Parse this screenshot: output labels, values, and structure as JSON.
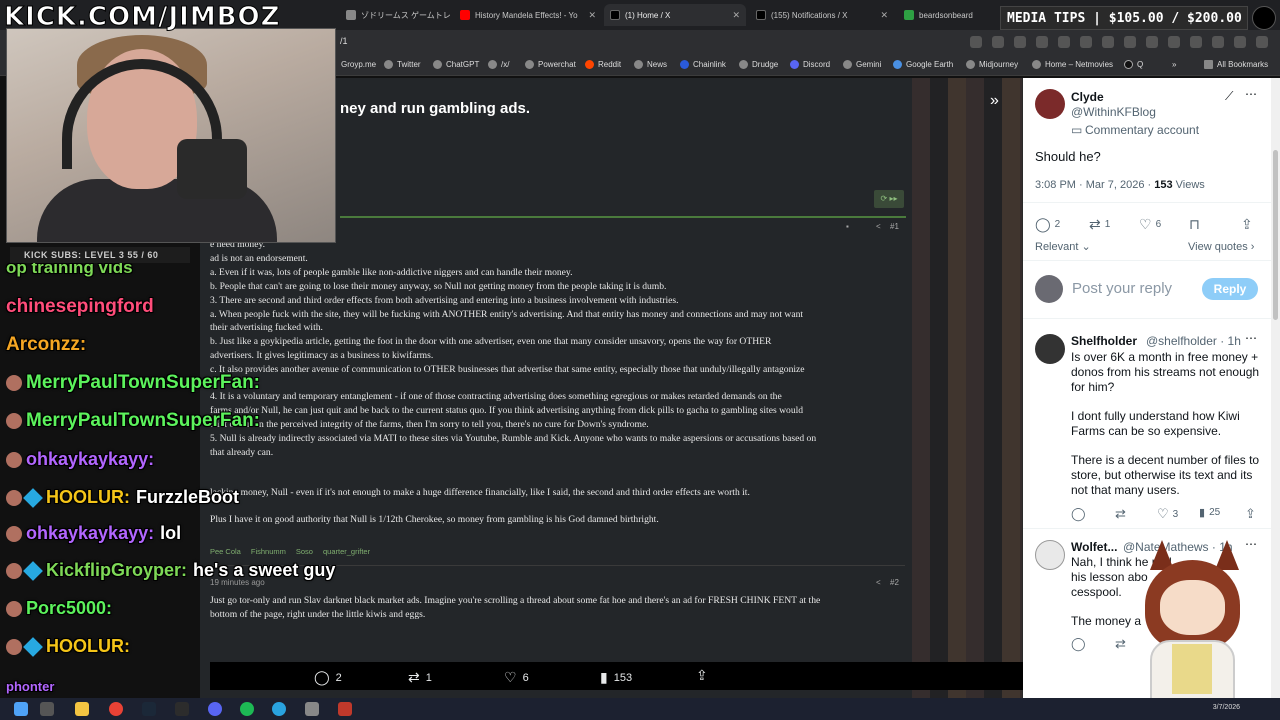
{
  "overlay": {
    "kick_logo": "KICK.COM/JIMBOZ",
    "media_tips": "MEDIA TIPS | $105.00 / $200.00",
    "subs": "KICK SUBS: LEVEL 3 55 / 60"
  },
  "browser": {
    "tabs": [
      {
        "label": "ゾドリームス ゲームトレ",
        "color": "#888"
      },
      {
        "label": "History Mandela Effects! - Yo",
        "color": "#ff0000"
      },
      {
        "label": "(1) Home / X",
        "color": "#000000"
      },
      {
        "label": "(155) Notifications / X",
        "color": "#000000"
      },
      {
        "label": "beardsonbeard",
        "color": "#2ea043"
      }
    ],
    "url": "/1",
    "bookmarks": [
      "Groyp.me",
      "Twitter",
      "ChatGPT",
      "/x/",
      "Powerchat",
      "Reddit",
      "News",
      "Chainlink",
      "Drudge",
      "Discord",
      "Gemini",
      "Google Earth",
      "Midjourney",
      "Home – Netmovies",
      "Q",
      "All Bookmarks"
    ]
  },
  "forum": {
    "thread_title": "ney and run gambling ads.",
    "post1_num": "#1",
    "post1_lines": [
      "e need money.",
      "ad is not an endorsement.",
      "a. Even if it was, lots of people gamble like non-addictive niggers and can handle their money.",
      "b. People that can't are going to lose their money anyway, so Null not getting money from the people taking it is dumb.",
      "3. There are second and third order effects from both advertising and entering into a business involvement with industries.",
      "a. When people fuck with the site, they will be fucking with ANOTHER entity's advertising. And that entity has money and connections and may not want",
      "their advertising fucked with.",
      "b. Just like a goykipedia article, getting the foot in the door with one advertiser, even one that many consider unsavory, opens the way for OTHER",
      "advertisers. It gives legitimacy as a business to kiwifarms.",
      "c. It also provides another avenue of communication to OTHER businesses that advertise that same entity, especially those that unduly/illegally antagonize",
      "",
      "4. It is a voluntary and temporary entanglement - if one of those contracting advertising does something egregious or makes retarded demands on the",
      "farms and/or Null, he can just quit and be back to the current status quo. If you think advertising anything from dick pills to gacha to gambling sites would",
      "taint or d         n on the perceived integrity of the farms, then I'm sorry to tell you, there's no cure for Down's syndrome.",
      "5. Null is already indirectly associated via MATI to these sites via Youtube, Rumble and Kick. Anyone who wants to make aspersions or accusations based on",
      "that already can.",
      "",
      "",
      "         lacking money, Null - even if it's not enough to make a huge difference financially, like I said, the second and third order effects are worth it.",
      "",
      "Plus I have it on good authority that Null is 1/12th Cherokee, so money from gambling is his God damned birthright."
    ],
    "reactions": [
      "Pee Cola",
      "Fishnumm",
      "Soso",
      "quarter_grifter"
    ],
    "post2_ago": "19 minutes ago",
    "post2_num": "#2",
    "post2_lines": [
      "Just go tor-only and run Slav darknet black market ads. Imagine you're scrolling a thread about some fat hoe and there's an ad for FRESH CHINK FENT at the",
      "bottom of the page, right under the little kiwis and eggs."
    ]
  },
  "chat": [
    {
      "user": "op training vids",
      "text": "",
      "color": "#7ed957"
    },
    {
      "user": "chinesepingford",
      "text": "",
      "color": "#ff4d7a"
    },
    {
      "user": "Arconzz:",
      "text": "",
      "color": "#f5a623"
    },
    {
      "user": "MerryPaulTownSuperFan:",
      "text": "",
      "color": "#5cf25c"
    },
    {
      "user": "MerryPaulTownSuperFan:",
      "text": "",
      "color": "#5cf25c"
    },
    {
      "user": "ohkaykaykayy:",
      "text": "",
      "color": "#b266ff"
    },
    {
      "user": "HOOLUR:",
      "text": "FurzzleBoot",
      "color": "#f5c518"
    },
    {
      "user": "ohkaykaykayy:",
      "text": "lol",
      "color": "#b266ff"
    },
    {
      "user": "KickflipGroyper:",
      "text": "he's a sweet guy",
      "color": "#7ed957"
    },
    {
      "user": "Porc5000:",
      "text": "",
      "color": "#5cf25c"
    },
    {
      "user": "HOOLUR:",
      "text": "",
      "color": "#f5c518"
    },
    {
      "user": "phonter",
      "text": "",
      "color": "#b266ff"
    }
  ],
  "engagement": {
    "replies": "2",
    "reposts": "1",
    "likes": "6",
    "views": "153"
  },
  "twitter": {
    "author_name": "Clyde",
    "author_handle": "@WithinKFBlog",
    "author_label": "Commentary account",
    "tweet_text": "Should he?",
    "timestamp": "3:08 PM · Mar 7, 2026 · ",
    "views_count": "153",
    "views_label": " Views",
    "replies": "2",
    "reposts": "1",
    "likes": "6",
    "relevant": "Relevant",
    "view_quotes": "View quotes",
    "reply_placeholder": "Post your reply",
    "reply_button": "Reply",
    "replies_list": [
      {
        "name": "Shelfholder",
        "handle": "@shelfholder · 1h",
        "lines": [
          "Is over 6K a month in free money +",
          "donos from his streams not enough",
          "for him?",
          "",
          "I dont fully understand how Kiwi",
          "Farms can be so expensive.",
          "",
          "There is a decent number of files to",
          "store, but otherwise its text and its",
          "not that many users."
        ],
        "likes": "3",
        "views": "25"
      },
      {
        "name": "Wolfet...",
        "handle": "@NateMathews · 1h",
        "lines": [
          "Nah, I think he             ned",
          "his lesson abo",
          "cesspool.",
          "",
          "The money a"
        ]
      }
    ]
  },
  "taskbar": {
    "date": "3/7/2026"
  }
}
